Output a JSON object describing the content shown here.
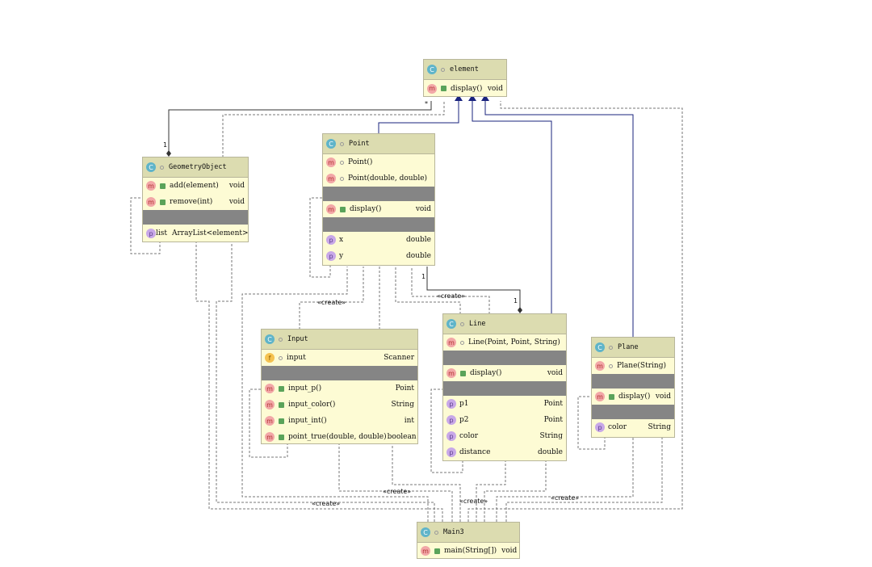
{
  "classes": {
    "element": {
      "icon": "C",
      "name": "element",
      "methods": [
        {
          "name": "display()",
          "type": "void"
        }
      ]
    },
    "geometry": {
      "icon": "C",
      "name": "GeometryObject",
      "methods": [
        {
          "name": "add(element)",
          "type": "void"
        },
        {
          "name": "remove(int)",
          "type": "void"
        }
      ],
      "props": [
        {
          "name": "list",
          "type": "ArrayList<element>"
        }
      ]
    },
    "point": {
      "icon": "C",
      "name": "Point",
      "ctors": [
        {
          "name": "Point()"
        },
        {
          "name": "Point(double, double)"
        }
      ],
      "methods": [
        {
          "name": "display()",
          "type": "void"
        }
      ],
      "props": [
        {
          "name": "x",
          "type": "double"
        },
        {
          "name": "y",
          "type": "double"
        }
      ]
    },
    "input": {
      "icon": "C",
      "name": "Input",
      "fields": [
        {
          "name": "input",
          "type": "Scanner"
        }
      ],
      "methods": [
        {
          "name": "input_p()",
          "type": "Point"
        },
        {
          "name": "input_color()",
          "type": "String"
        },
        {
          "name": "input_int()",
          "type": "int"
        },
        {
          "name": "point_true(double, double)",
          "type": "boolean"
        }
      ]
    },
    "line": {
      "icon": "C",
      "name": "Line",
      "ctors": [
        {
          "name": "Line(Point, Point, String)"
        }
      ],
      "methods": [
        {
          "name": "display()",
          "type": "void"
        }
      ],
      "props": [
        {
          "name": "p1",
          "type": "Point"
        },
        {
          "name": "p2",
          "type": "Point"
        },
        {
          "name": "color",
          "type": "String"
        },
        {
          "name": "distance",
          "type": "double"
        }
      ]
    },
    "plane": {
      "icon": "C",
      "name": "Plane",
      "ctors": [
        {
          "name": "Plane(String)"
        }
      ],
      "methods": [
        {
          "name": "display()",
          "type": "void"
        }
      ],
      "props": [
        {
          "name": "color",
          "type": "String"
        }
      ]
    },
    "main": {
      "icon": "C",
      "name": "Main3",
      "methods": [
        {
          "name": "main(String[])",
          "type": "void"
        }
      ]
    }
  },
  "labels": {
    "create": "«create»",
    "one": "1",
    "star": "*"
  },
  "icons": {
    "class": "class-icon",
    "method": "method-icon",
    "property": "property-icon",
    "field": "field-icon"
  },
  "colors": {
    "header": "#dcdcb0",
    "body": "#fdfbd4",
    "inherit": "#1a237e",
    "dashed": "#777777"
  }
}
